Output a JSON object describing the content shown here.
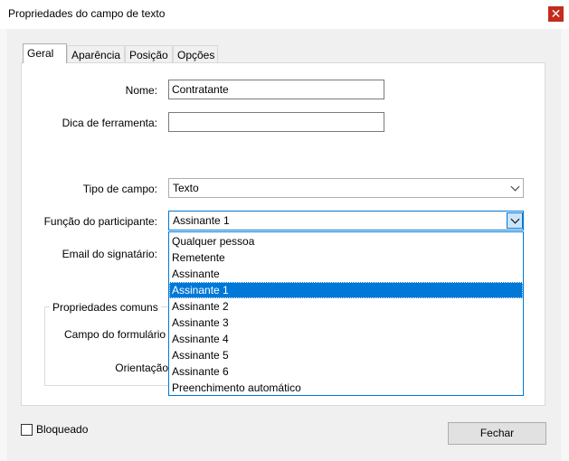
{
  "window": {
    "title": "Propriedades do campo de texto",
    "close_glyph": "✕"
  },
  "tabs": [
    {
      "label": "Geral",
      "active": true
    },
    {
      "label": "Aparência",
      "active": false
    },
    {
      "label": "Posição",
      "active": false
    },
    {
      "label": "Opções",
      "active": false
    }
  ],
  "form": {
    "name_label": "Nome:",
    "name_value": "Contratante",
    "tooltip_label": "Dica de ferramenta:",
    "tooltip_value": "",
    "field_type_label": "Tipo de campo:",
    "field_type_value": "Texto",
    "role_label": "Função do participante:",
    "role_value": "Assinante 1",
    "email_label": "Email do signatário:"
  },
  "common": {
    "title": "Propriedades comuns",
    "form_field_label": "Campo do formulário",
    "orientation_label": "Orientação"
  },
  "dropdown": {
    "items": [
      "Qualquer pessoa",
      "Remetente",
      "Assinante",
      "Assinante 1",
      "Assinante 2",
      "Assinante 3",
      "Assinante 4",
      "Assinante 5",
      "Assinante 6",
      "Preenchimento automático"
    ],
    "selected": "Assinante 1"
  },
  "footer": {
    "locked_label": "Bloqueado",
    "locked_checked": false,
    "close_button": "Fechar"
  },
  "colors": {
    "accent": "#0078d7",
    "close": "#c42b1c",
    "dialog_bg": "#f0f0f0"
  },
  "icons": {
    "close": "close-icon",
    "dropdown": "chevron-down-icon"
  }
}
